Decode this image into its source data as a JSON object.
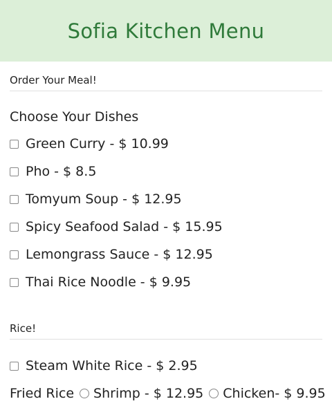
{
  "header": {
    "title": "Sofia Kitchen Menu"
  },
  "order_section": {
    "title": "Order Your Meal!",
    "group_heading": "Choose Your Dishes",
    "dishes": [
      "Green Curry - $ 10.99",
      "Pho - $ 8.5",
      "Tomyum Soup - $ 12.95",
      "Spicy Seafood Salad - $ 15.95",
      "Lemongrass Sauce - $ 12.95",
      "Thai Rice Noodle - $ 9.95"
    ]
  },
  "rice_section": {
    "title": "Rice!",
    "steam_rice": "Steam White Rice - $ 2.95",
    "fried_rice_label": "Fried Rice",
    "fried_rice_options": [
      "Shrimp - $ 12.95",
      "Chicken- $ 9.95"
    ]
  }
}
